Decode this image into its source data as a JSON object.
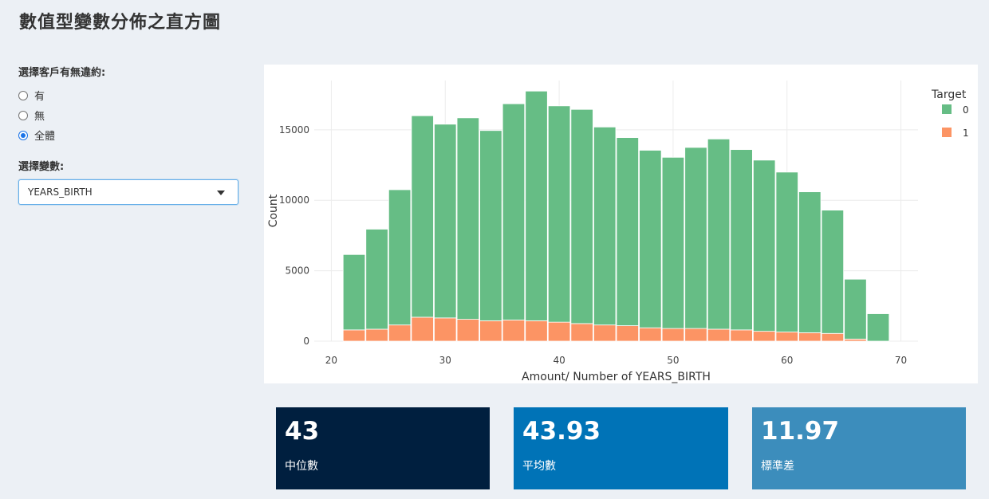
{
  "page": {
    "title": "數值型變數分佈之直方圖"
  },
  "sidebar": {
    "radio_label": "選擇客戶有無違約:",
    "radio_options": [
      {
        "label": "有",
        "checked": false
      },
      {
        "label": "無",
        "checked": false
      },
      {
        "label": "全體",
        "checked": true
      }
    ],
    "select_label": "選擇變數:",
    "select_value": "YEARS_BIRTH"
  },
  "value_boxes": [
    {
      "value": "43",
      "caption": "中位數",
      "color": "#001f3f"
    },
    {
      "value": "43.93",
      "caption": "平均數",
      "color": "#0073b7"
    },
    {
      "value": "11.97",
      "caption": "標準差",
      "color": "#3c8dbc"
    }
  ],
  "chart_data": {
    "type": "bar",
    "stacked": true,
    "xlabel": "Amount/ Number of YEARS_BIRTH",
    "ylabel": "Count",
    "xlim": [
      18.5,
      71.5
    ],
    "ylim": [
      0,
      18500
    ],
    "x_ticks": [
      20,
      30,
      40,
      50,
      60,
      70
    ],
    "y_ticks": [
      0,
      5000,
      10000,
      15000
    ],
    "grid": true,
    "legend": {
      "title": "Target",
      "placement": "top-right"
    },
    "bin_width": 2,
    "x": [
      22,
      24,
      26,
      28,
      30,
      32,
      34,
      36,
      38,
      40,
      42,
      44,
      46,
      48,
      50,
      52,
      54,
      56,
      58,
      60,
      62,
      64,
      66,
      68
    ],
    "series": [
      {
        "name": "0",
        "color": "#66bd85",
        "values": [
          5350,
          7100,
          9600,
          14300,
          13750,
          14300,
          13500,
          15350,
          16300,
          15350,
          15200,
          14050,
          13350,
          12600,
          12150,
          12850,
          13500,
          12800,
          12150,
          11350,
          10000,
          8750,
          4250,
          1950
        ]
      },
      {
        "name": "1",
        "color": "#fc9464",
        "values": [
          800,
          850,
          1150,
          1700,
          1650,
          1550,
          1450,
          1500,
          1450,
          1350,
          1250,
          1150,
          1100,
          950,
          900,
          900,
          850,
          800,
          700,
          650,
          600,
          550,
          150,
          0
        ]
      }
    ]
  }
}
